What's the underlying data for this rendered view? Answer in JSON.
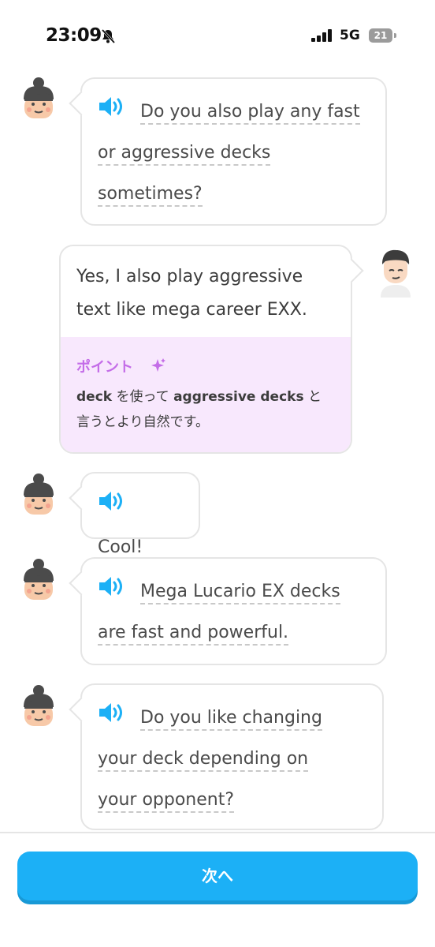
{
  "status_bar": {
    "time": "23:09",
    "network": "5G",
    "battery": "21"
  },
  "chat": {
    "msg1": {
      "lines": [
        "Do you also play any fast",
        "or aggressive decks",
        "sometimes?"
      ]
    },
    "reply": {
      "lines": [
        "Yes, I also play aggressive",
        "text like mega career EXX."
      ],
      "tip": {
        "title": "ポイント",
        "bold1": "deck",
        "text1": " を使って ",
        "bold2": "aggressive decks",
        "text2": " と",
        "line2": "言うとより自然です。"
      }
    },
    "msg2": {
      "lines": [
        "Cool!"
      ]
    },
    "msg3": {
      "lines": [
        "Mega Lucario EX decks",
        "are fast and powerful."
      ]
    },
    "msg4": {
      "lines": [
        "Do you like changing",
        "your deck depending on",
        "your opponent?"
      ]
    }
  },
  "footer": {
    "next_label": "次へ"
  },
  "colors": {
    "accent": "#1cb0f6",
    "speaker": "#1cb0f6",
    "tip_bg": "#f8e8fd",
    "tip_title": "#c46de8"
  }
}
